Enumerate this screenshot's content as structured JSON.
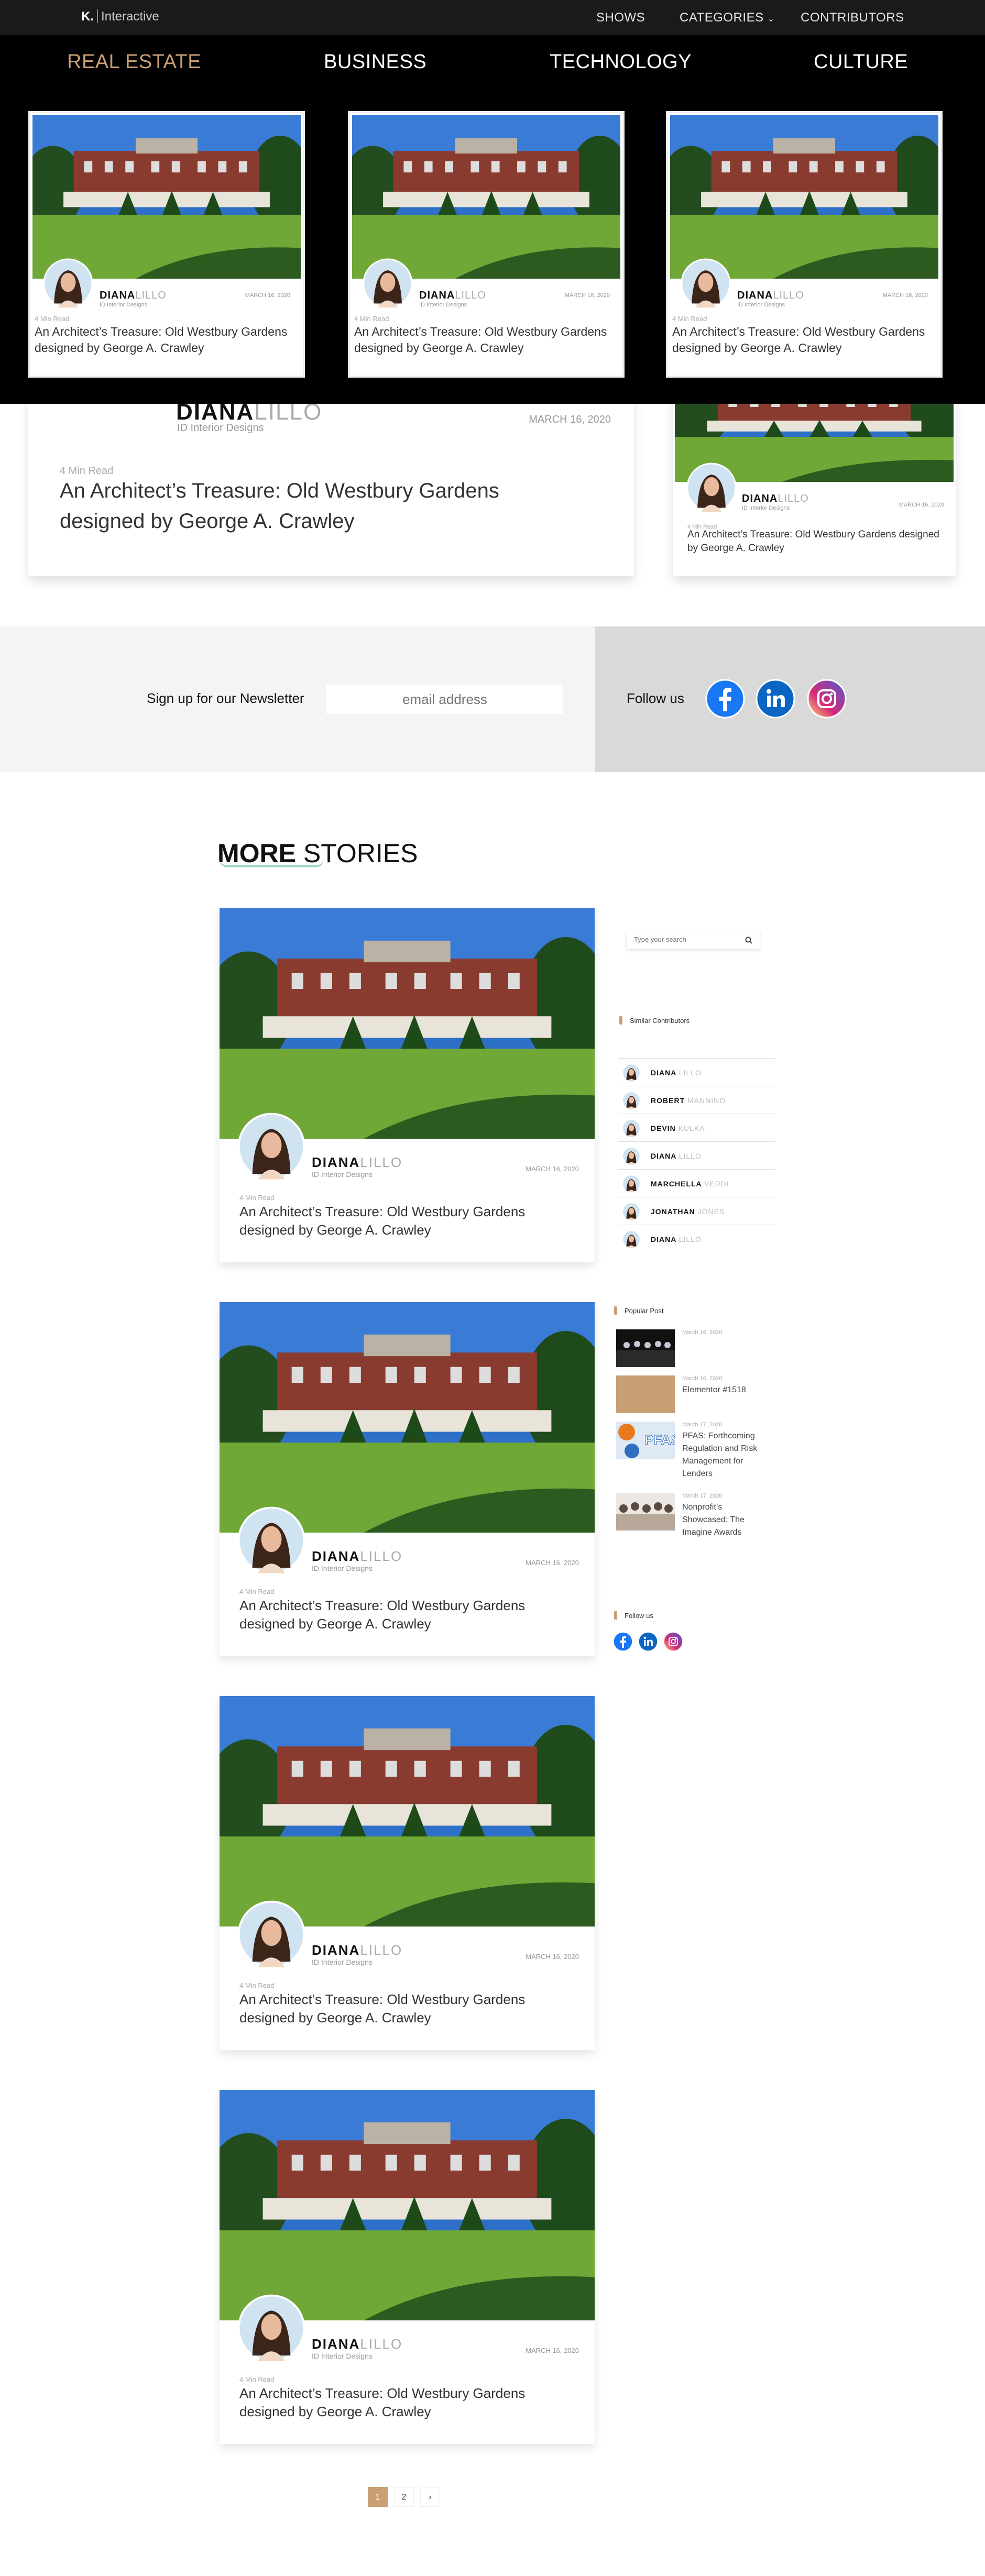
{
  "header": {
    "logo_mark": "K.",
    "logo_text": "Interactive",
    "nav": [
      "SHOWS",
      "CATEGORIES",
      "CONTRIBUTORS"
    ]
  },
  "mega_menu": {
    "categories": [
      "REAL ESTATE",
      "BUSINESS",
      "TECHNOLOGY",
      "CULTURE"
    ],
    "active_category": "REAL ESTATE",
    "cards": [
      {
        "author_first": "DIANA",
        "author_last": "LILLO",
        "role": "ID Interior Designs",
        "date": "MARCH 16, 2020",
        "read": "4 Min Read",
        "title": "An Architect’s Treasure: Old Westbury Gardens designed by George A. Crawley"
      },
      {
        "author_first": "DIANA",
        "author_last": "LILLO",
        "role": "ID Interior Designs",
        "date": "MARCH 16, 2020",
        "read": "4 Min Read",
        "title": "An Architect’s Treasure: Old Westbury Gardens designed by George A. Crawley"
      },
      {
        "author_first": "DIANA",
        "author_last": "LILLO",
        "role": "ID Interior Designs",
        "date": "MARCH 16, 2020",
        "read": "4 Min Read",
        "title": "An Architect’s Treasure: Old Westbury Gardens designed by George A. Crawley"
      }
    ]
  },
  "featured": {
    "author_first": "DIANA",
    "author_last": "LILLO",
    "role": "ID Interior Designs",
    "date": "MARCH 16, 2020",
    "read": "4 Min Read",
    "title": "An Architect’s Treasure: Old Westbury Gardens designed by George A. Crawley"
  },
  "side_featured": {
    "author_first": "DIANA",
    "author_last": "LILLO",
    "role": "ID Interior Designs",
    "date": "MARCH 16, 2020",
    "read": "4 Min Read",
    "title": "An Architect’s Treasure: Old Westbury Gardens designed by George A. Crawley"
  },
  "newsletter": {
    "label": "Sign up for our Newsletter",
    "placeholder": "email address",
    "follow_label": "Follow us"
  },
  "more_stories": {
    "title_bold": "MORE",
    "title_rest": " STORIES",
    "cards": [
      {
        "author_first": "DIANA",
        "author_last": "LILLO",
        "role": "ID Interior Designs",
        "date": "MARCH 16, 2020",
        "read": "4 Min Read",
        "title": "An Architect’s Treasure: Old Westbury Gardens designed by George A. Crawley"
      },
      {
        "author_first": "DIANA",
        "author_last": "LILLO",
        "role": "ID Interior Designs",
        "date": "MARCH 16, 2020",
        "read": "4 Min Read",
        "title": "An Architect’s Treasure: Old Westbury Gardens designed by George A. Crawley"
      },
      {
        "author_first": "DIANA",
        "author_last": "LILLO",
        "role": "ID Interior Designs",
        "date": "MARCH 16, 2020",
        "read": "4 Min Read",
        "title": "An Architect’s Treasure: Old Westbury Gardens designed by George A. Crawley"
      },
      {
        "author_first": "DIANA",
        "author_last": "LILLO",
        "role": "ID Interior Designs",
        "date": "MARCH 16, 2020",
        "read": "4 Min Read",
        "title": "An Architect’s Treasure: Old Westbury Gardens designed by George A. Crawley"
      }
    ]
  },
  "sidebar": {
    "search_placeholder": "Type your search",
    "similar_title": "Similar Contributors",
    "contributors": [
      {
        "first": "DIANA",
        "last": "LILLO"
      },
      {
        "first": "ROBERT",
        "last": "MANNINO"
      },
      {
        "first": "DEVIN",
        "last": "KULKA"
      },
      {
        "first": "DIANA",
        "last": "LILLO"
      },
      {
        "first": "MARCHELLA",
        "last": "VERDI"
      },
      {
        "first": "JONATHAN",
        "last": "JONES"
      },
      {
        "first": "DIANA",
        "last": "LILLO"
      }
    ],
    "popular_title": "Popular Post",
    "popular": [
      {
        "date": "March 16, 2020",
        "title": ""
      },
      {
        "date": "March 16, 2020",
        "title": "Elementor #1518"
      },
      {
        "date": "March 17, 2020",
        "title": "PFAS: Forthcoming Regulation and Risk Management for Lenders"
      },
      {
        "date": "March 17, 2020",
        "title": "Nonprofit’s Showcased: The Imagine Awards"
      }
    ],
    "follow_title": "Follow us"
  },
  "pagination": {
    "pages": [
      "1",
      "2"
    ],
    "next": "›",
    "current": "1"
  },
  "colors": {
    "accent": "#c9a074",
    "facebook": "#1877f2",
    "linkedin": "#0a66c2"
  }
}
